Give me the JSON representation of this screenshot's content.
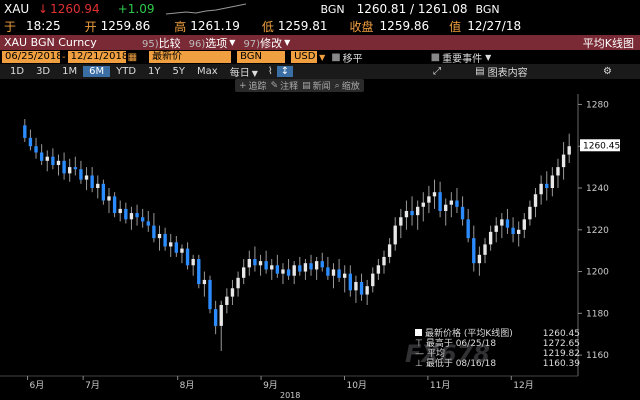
{
  "quote": {
    "ticker": "XAU",
    "arrow": "↓",
    "last": "1260.94",
    "change": "+1.09",
    "src1": "BGN",
    "bid_ask": "1260.81 / 1261.08",
    "src2": "BGN",
    "time_label": "于",
    "time": "18:25",
    "open_label": "开",
    "open": "1259.86",
    "high_label": "高",
    "high": "1261.19",
    "low_label": "低",
    "low": "1259.81",
    "close_label": "收盘",
    "close": "1259.86",
    "value_label": "值",
    "value_date": "12/27/18"
  },
  "toolbar": {
    "security": "XAU BGN Curncy",
    "compare_num": "95)",
    "compare": "比较",
    "options_num": "96)",
    "options": "选项",
    "edit_num": "97)",
    "edit": "修改",
    "right_title": "平均K线图"
  },
  "fields": {
    "date_from": "06/25/2018",
    "date_to": "12/21/2018",
    "series": "最新价",
    "source": "BGN",
    "currency": "USD",
    "move_label": "移平",
    "events_label": "重要事件"
  },
  "periods": [
    "1D",
    "3D",
    "1M",
    "6M",
    "YTD",
    "1Y",
    "5Y",
    "Max"
  ],
  "active_period": "6M",
  "freq": "每日",
  "tools": {
    "chart_icon": "↕",
    "table_label": "图表内容",
    "gear": "⚙",
    "expand": "⤢"
  },
  "actions": [
    "追踪",
    "注释",
    "新闻",
    "缩放"
  ],
  "legend": {
    "items": [
      {
        "label": "最新价格 (平均K线图)",
        "value": "1260.45"
      },
      {
        "label": "最高于 06/25/18",
        "value": "1272.65"
      },
      {
        "label": "平均",
        "value": "1219.82"
      },
      {
        "label": "最低于 08/16/18",
        "value": "1160.39"
      }
    ]
  },
  "last_tag": "1260.45",
  "watermark": "FX678",
  "colors": {
    "up": "#e8e8e8",
    "down": "#2a8cff",
    "bg": "#000000",
    "accent": "#7a2a35",
    "field": "#f0a040"
  },
  "chart_data": {
    "type": "candlestick",
    "title": "",
    "ylim": [
      1150,
      1285
    ],
    "yticks": [
      1160,
      1180,
      1200,
      1220,
      1240,
      1260,
      1280
    ],
    "month_labels": [
      "6月",
      "7月",
      "8月",
      "9月",
      "10月",
      "11月",
      "12月"
    ],
    "year_label": "2018",
    "grid": false,
    "candles": [
      [
        1270,
        1273,
        1262,
        1264
      ],
      [
        1264,
        1268,
        1258,
        1260
      ],
      [
        1260,
        1264,
        1254,
        1257
      ],
      [
        1257,
        1261,
        1251,
        1253
      ],
      [
        1253,
        1258,
        1248,
        1255
      ],
      [
        1255,
        1259,
        1249,
        1251
      ],
      [
        1251,
        1256,
        1246,
        1253
      ],
      [
        1253,
        1257,
        1244,
        1247
      ],
      [
        1247,
        1254,
        1243,
        1250
      ],
      [
        1250,
        1255,
        1246,
        1249
      ],
      [
        1249,
        1253,
        1242,
        1244
      ],
      [
        1244,
        1250,
        1239,
        1246
      ],
      [
        1246,
        1250,
        1238,
        1240
      ],
      [
        1240,
        1246,
        1235,
        1242
      ],
      [
        1242,
        1244,
        1232,
        1234
      ],
      [
        1234,
        1240,
        1228,
        1236
      ],
      [
        1236,
        1238,
        1226,
        1228
      ],
      [
        1228,
        1234,
        1224,
        1230
      ],
      [
        1230,
        1233,
        1223,
        1225
      ],
      [
        1225,
        1231,
        1220,
        1228
      ],
      [
        1228,
        1232,
        1222,
        1226
      ],
      [
        1226,
        1230,
        1221,
        1224
      ],
      [
        1224,
        1229,
        1219,
        1222
      ],
      [
        1222,
        1228,
        1214,
        1216
      ],
      [
        1216,
        1222,
        1210,
        1218
      ],
      [
        1218,
        1221,
        1210,
        1212
      ],
      [
        1212,
        1218,
        1207,
        1214
      ],
      [
        1214,
        1217,
        1207,
        1209
      ],
      [
        1209,
        1213,
        1204,
        1211
      ],
      [
        1211,
        1214,
        1201,
        1203
      ],
      [
        1203,
        1208,
        1198,
        1206
      ],
      [
        1206,
        1208,
        1192,
        1194
      ],
      [
        1194,
        1200,
        1188,
        1196
      ],
      [
        1196,
        1198,
        1180,
        1182
      ],
      [
        1182,
        1186,
        1170,
        1174
      ],
      [
        1174,
        1186,
        1162,
        1184
      ],
      [
        1184,
        1192,
        1180,
        1188
      ],
      [
        1188,
        1196,
        1184,
        1192
      ],
      [
        1192,
        1200,
        1188,
        1197
      ],
      [
        1197,
        1206,
        1194,
        1202
      ],
      [
        1202,
        1210,
        1198,
        1206
      ],
      [
        1206,
        1212,
        1200,
        1203
      ],
      [
        1203,
        1208,
        1198,
        1205
      ],
      [
        1205,
        1210,
        1199,
        1201
      ],
      [
        1201,
        1206,
        1196,
        1203
      ],
      [
        1203,
        1208,
        1197,
        1199
      ],
      [
        1199,
        1204,
        1194,
        1201
      ],
      [
        1201,
        1206,
        1196,
        1198
      ],
      [
        1198,
        1205,
        1194,
        1203
      ],
      [
        1203,
        1207,
        1198,
        1200
      ],
      [
        1200,
        1206,
        1196,
        1204
      ],
      [
        1204,
        1208,
        1198,
        1201
      ],
      [
        1201,
        1207,
        1196,
        1205
      ],
      [
        1205,
        1209,
        1200,
        1202
      ],
      [
        1202,
        1207,
        1196,
        1198
      ],
      [
        1198,
        1204,
        1192,
        1201
      ],
      [
        1201,
        1206,
        1195,
        1197
      ],
      [
        1197,
        1203,
        1190,
        1199
      ],
      [
        1199,
        1203,
        1188,
        1191
      ],
      [
        1191,
        1198,
        1185,
        1195
      ],
      [
        1195,
        1199,
        1186,
        1189
      ],
      [
        1189,
        1196,
        1184,
        1193
      ],
      [
        1193,
        1202,
        1190,
        1199
      ],
      [
        1199,
        1206,
        1196,
        1203
      ],
      [
        1203,
        1210,
        1199,
        1207
      ],
      [
        1207,
        1216,
        1204,
        1213
      ],
      [
        1213,
        1226,
        1210,
        1222
      ],
      [
        1222,
        1230,
        1216,
        1226
      ],
      [
        1226,
        1234,
        1220,
        1229
      ],
      [
        1229,
        1236,
        1222,
        1227
      ],
      [
        1227,
        1234,
        1220,
        1231
      ],
      [
        1231,
        1238,
        1224,
        1233
      ],
      [
        1233,
        1241,
        1228,
        1236
      ],
      [
        1236,
        1244,
        1230,
        1238
      ],
      [
        1238,
        1243,
        1226,
        1229
      ],
      [
        1229,
        1235,
        1222,
        1232
      ],
      [
        1232,
        1238,
        1226,
        1234
      ],
      [
        1234,
        1240,
        1228,
        1231
      ],
      [
        1231,
        1236,
        1222,
        1225
      ],
      [
        1225,
        1230,
        1214,
        1216
      ],
      [
        1216,
        1222,
        1200,
        1204
      ],
      [
        1204,
        1212,
        1198,
        1208
      ],
      [
        1208,
        1216,
        1204,
        1213
      ],
      [
        1213,
        1222,
        1210,
        1219
      ],
      [
        1219,
        1226,
        1214,
        1222
      ],
      [
        1222,
        1228,
        1216,
        1225
      ],
      [
        1225,
        1230,
        1218,
        1221
      ],
      [
        1221,
        1226,
        1214,
        1218
      ],
      [
        1218,
        1224,
        1212,
        1220
      ],
      [
        1220,
        1228,
        1216,
        1225
      ],
      [
        1225,
        1234,
        1222,
        1231
      ],
      [
        1231,
        1240,
        1226,
        1237
      ],
      [
        1237,
        1246,
        1232,
        1242
      ],
      [
        1242,
        1248,
        1234,
        1240
      ],
      [
        1240,
        1250,
        1236,
        1246
      ],
      [
        1246,
        1254,
        1240,
        1250
      ],
      [
        1250,
        1262,
        1244,
        1256
      ],
      [
        1256,
        1266,
        1252,
        1260
      ]
    ]
  }
}
